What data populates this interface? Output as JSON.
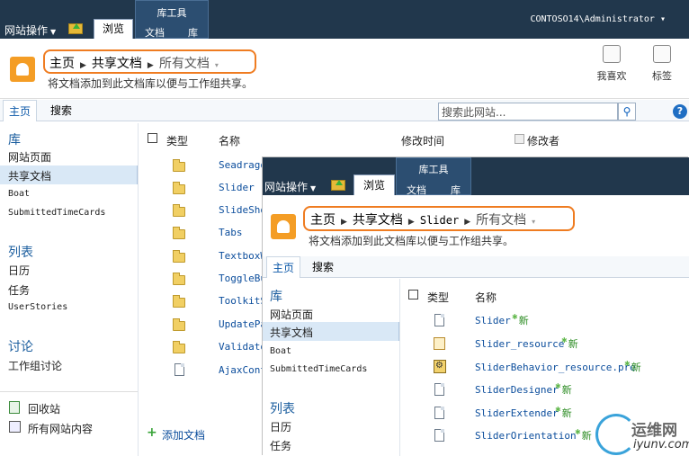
{
  "window1": {
    "site_actions": "网站操作",
    "tab_browse": "浏览",
    "lib_tools": "库工具",
    "tab_docs": "文档",
    "tab_lib": "库",
    "user": "CONTOSO14\\Administrator",
    "crumb": [
      "主页",
      "共享文档",
      "所有文档"
    ],
    "description": "将文档添加到此文档库以便与工作组共享。",
    "ribbon_btns": [
      "我喜欢",
      "标签"
    ],
    "topnav": [
      "主页",
      "搜索"
    ],
    "search_placeholder": "搜索此网站...",
    "help": "?",
    "quicklaunch": {
      "lib_heading": "库",
      "lib_items": [
        "网站页面",
        "共享文档",
        "Boat",
        "SubmittedTimeCards"
      ],
      "list_heading": "列表",
      "list_items": [
        "日历",
        "任务",
        "UserStories"
      ],
      "disc_heading": "讨论",
      "disc_items": [
        "工作组讨论"
      ],
      "recycle": "回收站",
      "all_content": "所有网站内容"
    },
    "columns": [
      "类型",
      "名称",
      "修改时间",
      "修改者"
    ],
    "files": [
      "Seadrago",
      "Slider",
      "SlideSho",
      "Tabs",
      "TextboxW",
      "ToggleBu",
      "ToolkitS",
      "UpdatePa",
      "Validato",
      "AjaxCont"
    ],
    "add_doc": "添加文档"
  },
  "window2": {
    "site_actions": "网站操作",
    "tab_browse": "浏览",
    "lib_tools": "库工具",
    "tab_docs": "文档",
    "tab_lib": "库",
    "crumb": [
      "主页",
      "共享文档",
      "Slider",
      "所有文档"
    ],
    "description": "将文档添加到此文档库以便与工作组共享。",
    "topnav": [
      "主页",
      "搜索"
    ],
    "quicklaunch": {
      "lib_heading": "库",
      "lib_items": [
        "网站页面",
        "共享文档",
        "Boat",
        "SubmittedTimeCards"
      ],
      "list_heading": "列表",
      "list_items": [
        "日历",
        "任务"
      ]
    },
    "columns": [
      "类型",
      "名称"
    ],
    "files": [
      {
        "name": "Slider",
        "new": "新"
      },
      {
        "name": "Slider_resource",
        "new": "新"
      },
      {
        "name": "SliderBehavior_resource.pre",
        "new": "新"
      },
      {
        "name": "SliderDesigner",
        "new": "新"
      },
      {
        "name": "SliderExtender",
        "new": "新"
      },
      {
        "name": "SliderOrientation",
        "new": "新"
      }
    ]
  },
  "watermark": {
    "line1": "运维网",
    "line2": "iyunv.com"
  }
}
